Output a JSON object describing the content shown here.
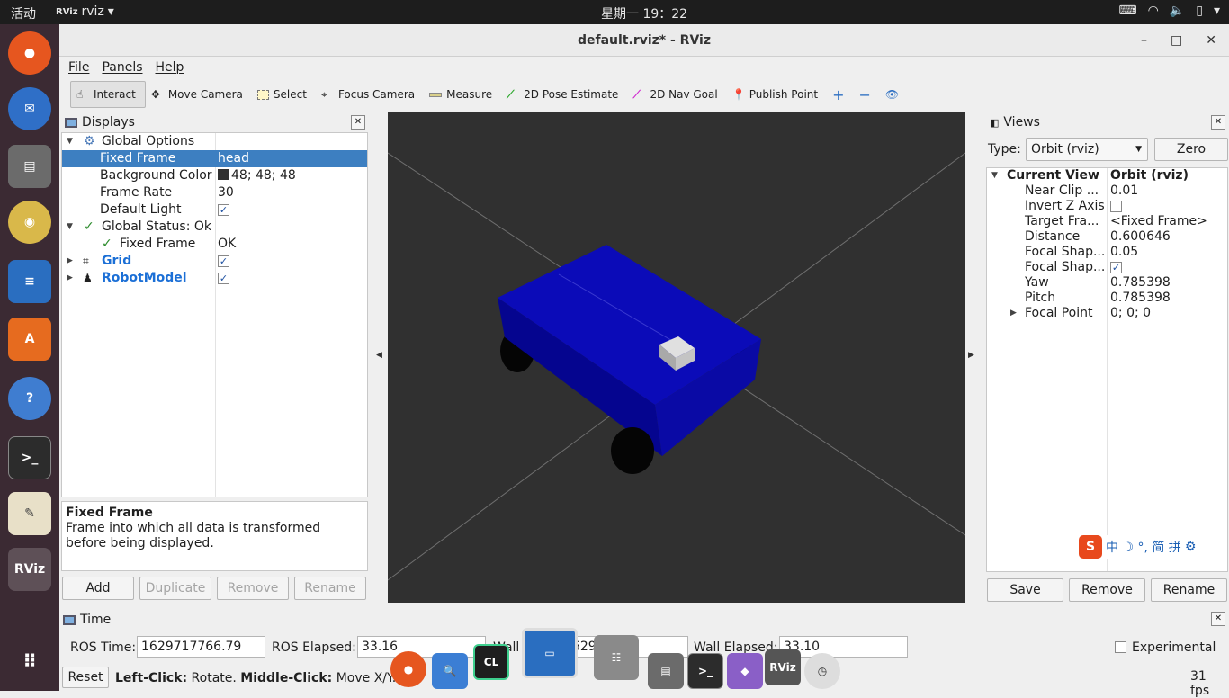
{
  "topbar": {
    "activities": "活动",
    "app_name": "rviz",
    "app_logo": "RViz",
    "clock": "星期一 19：22",
    "tray_icons": [
      "keyboard-icon",
      "wifi-icon",
      "volume-icon",
      "battery-icon",
      "power-menu-icon"
    ]
  },
  "dock": {
    "items": [
      "firefox-icon",
      "thunderbird-icon",
      "files-icon",
      "rhythmbox-icon",
      "writer-icon",
      "software-icon",
      "help-icon",
      "terminal-icon",
      "editor-icon",
      "rviz-icon",
      "app-grid-icon"
    ],
    "rviz_label": "RViz"
  },
  "window": {
    "title": "default.rviz* - RViz",
    "controls": {
      "minimize": "–",
      "maximize": "□",
      "close": "✕"
    }
  },
  "menu": {
    "file": "File",
    "panels": "Panels",
    "help": "Help"
  },
  "toolbar": {
    "interact": "Interact",
    "move_camera": "Move Camera",
    "select": "Select",
    "focus_camera": "Focus Camera",
    "measure": "Measure",
    "pose_estimate": "2D Pose Estimate",
    "nav_goal": "2D Nav Goal",
    "publish_point": "Publish Point",
    "plus": "+",
    "minus": "−",
    "eye": "👁"
  },
  "displays": {
    "title": "Displays",
    "rows": {
      "global_options": "Global Options",
      "fixed_frame_k": "Fixed Frame",
      "fixed_frame_v": "head",
      "bg_color_k": "Background Color",
      "bg_color_v": "48; 48; 48",
      "frame_rate_k": "Frame Rate",
      "frame_rate_v": "30",
      "default_light_k": "Default Light",
      "global_status": "Global Status: Ok",
      "status_fixed_frame_k": "Fixed Frame",
      "status_fixed_frame_v": "OK",
      "grid": "Grid",
      "robot_model": "RobotModel"
    },
    "description": {
      "title": "Fixed Frame",
      "text": "Frame into which all data is transformed before being displayed."
    },
    "buttons": {
      "add": "Add",
      "duplicate": "Duplicate",
      "remove": "Remove",
      "rename": "Rename"
    }
  },
  "views": {
    "title": "Views",
    "type_label": "Type:",
    "type_value": "Orbit (rviz)",
    "zero": "Zero",
    "rows": {
      "current_view_k": "Current View",
      "current_view_v": "Orbit (rviz)",
      "near_clip_k": "Near Clip ...",
      "near_clip_v": "0.01",
      "invert_z_k": "Invert Z Axis",
      "target_frame_k": "Target Fra...",
      "target_frame_v": "<Fixed Frame>",
      "distance_k": "Distance",
      "distance_v": "0.600646",
      "focal_shape1_k": "Focal Shap...",
      "focal_shape1_v": "0.05",
      "focal_shape2_k": "Focal Shap...",
      "yaw_k": "Yaw",
      "yaw_v": "0.785398",
      "pitch_k": "Pitch",
      "pitch_v": "0.785398",
      "focal_point_k": "Focal Point",
      "focal_point_v": "0; 0; 0"
    },
    "ime_bar": "中 ☽ °, 简 拼",
    "buttons": {
      "save": "Save",
      "remove": "Remove",
      "rename": "Rename"
    }
  },
  "time": {
    "title": "Time",
    "ros_time_label": "ROS Time:",
    "ros_time": "1629717766.79",
    "ros_elapsed_label": "ROS Elapsed:",
    "ros_elapsed": "33.16",
    "wall_label": "Wall",
    "wall_time": "1629.....82",
    "wall_elapsed_label": "Wall Elapsed:",
    "wall_elapsed": "33.10",
    "experimental": "Experimental",
    "reset": "Reset",
    "hint_bold1": "Left-Click:",
    "hint1": " Rotate. ",
    "hint_bold2": "Middle-Click:",
    "hint2": " Move X/Y. R",
    "hint3": "...Whe...M",
    "fps": "31 fps"
  },
  "colors": {
    "robot_body": "#0a0ab4",
    "background": "#303030",
    "selection": "#3d7fc1",
    "dock": "#3b2a33"
  }
}
